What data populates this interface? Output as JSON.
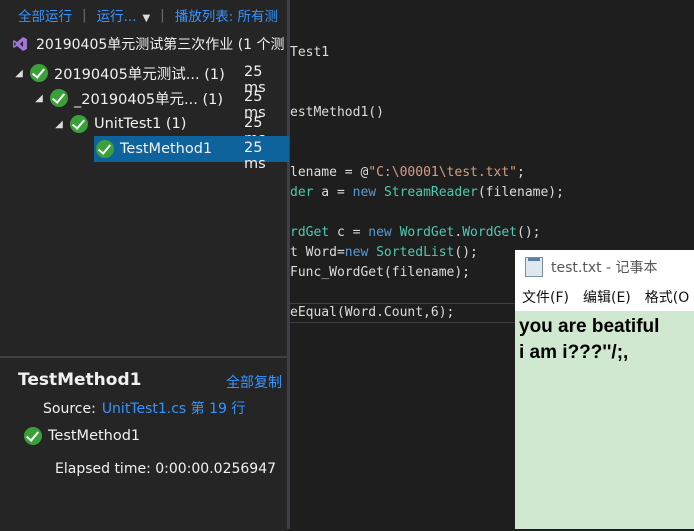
{
  "toolbar": {
    "run_all": "全部运行",
    "run": "运行...",
    "playlist": "播放列表: 所有测"
  },
  "tree": {
    "root_label": "20190405单元测试第三次作业 (1 个测",
    "rows": [
      {
        "label": "20190405单元测试... (1)",
        "duration": "25 ms"
      },
      {
        "label": "_20190405单元... (1)",
        "duration": "25 ms"
      },
      {
        "label": "UnitTest1 (1)",
        "duration": "25 ms"
      },
      {
        "label": "TestMethod1",
        "duration": "25 ms"
      }
    ]
  },
  "details": {
    "title": "TestMethod1",
    "copy_all": "全部复制",
    "source_label": "Source:",
    "source_link": "UnitTest1.cs 第 19 行",
    "result_name": "TestMethod1",
    "elapsed": "Elapsed time: 0:00:00.0256947"
  },
  "code": {
    "l1": "Test1",
    "l2": "estMethod1()",
    "l3a": "lename = @",
    "l3b": "\"C:\\00001\\test.txt\"",
    "l3c": ";",
    "l4a": "der",
    "l4b": " a = ",
    "l4c": "new",
    "l4d": "StreamReader",
    "l4e": "(filename);",
    "l5a": "rdGet",
    "l5b": " c = ",
    "l5c": "new",
    "l5d": "WordGet",
    "l5e": ".",
    "l5f": "WordGet",
    "l5g": "();",
    "l6a": "t Word=",
    "l6b": "new",
    "l6c": "SortedList",
    "l6d": "();",
    "l7": "Func_WordGet(filename);",
    "l8": "eEqual(Word.Count,6);"
  },
  "notepad": {
    "title": "test.txt - 记事本",
    "menu": [
      "文件(F)",
      "编辑(E)",
      "格式(O"
    ],
    "line1": "you are beatiful",
    "line2": "i am i???''/;,"
  },
  "colors": {
    "accent": "#3794ff",
    "pass": "#3aa03a",
    "selected": "#0e639c",
    "notepad_bg": "#cfe8cf"
  }
}
